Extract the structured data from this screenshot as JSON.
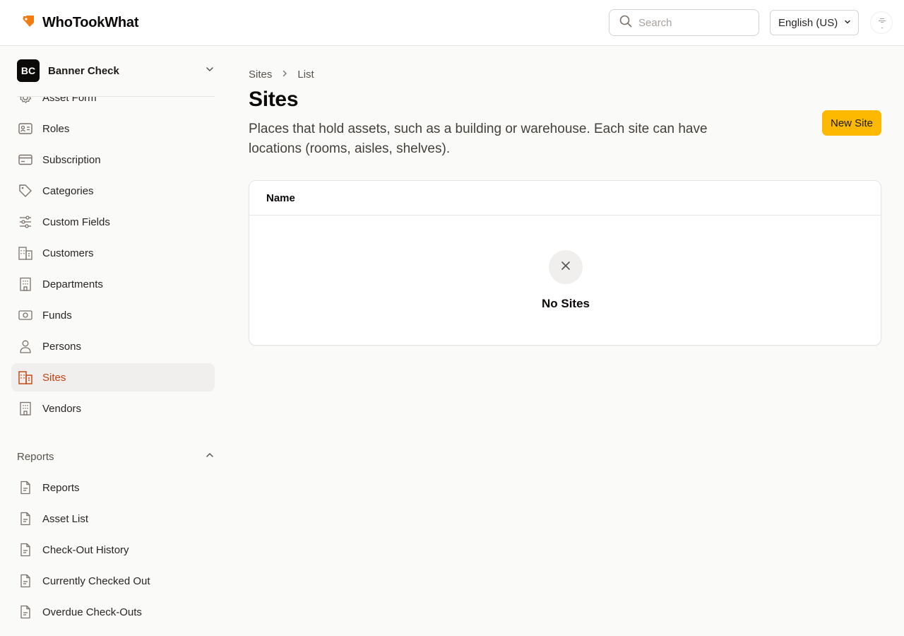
{
  "app": {
    "name": "WhoTookWhat",
    "brand_color": "#f07c12",
    "accent_color": "#fcb900"
  },
  "header": {
    "search_placeholder": "Search",
    "language": "English (US)"
  },
  "org": {
    "initials": "BC",
    "name": "Banner Check"
  },
  "sidebar": {
    "items": [
      {
        "label": "Asset Form",
        "icon": "gear-icon"
      },
      {
        "label": "Roles",
        "icon": "id-card-icon"
      },
      {
        "label": "Subscription",
        "icon": "credit-card-icon"
      },
      {
        "label": "Categories",
        "icon": "tag-icon"
      },
      {
        "label": "Custom Fields",
        "icon": "sliders-icon"
      },
      {
        "label": "Customers",
        "icon": "buildings-icon"
      },
      {
        "label": "Departments",
        "icon": "building-icon"
      },
      {
        "label": "Funds",
        "icon": "banknote-icon"
      },
      {
        "label": "Persons",
        "icon": "person-icon"
      },
      {
        "label": "Sites",
        "icon": "buildings-icon",
        "active": true
      },
      {
        "label": "Vendors",
        "icon": "building-icon"
      }
    ],
    "reports_section": {
      "label": "Reports",
      "items": [
        {
          "label": "Reports",
          "icon": "document-icon"
        },
        {
          "label": "Asset List",
          "icon": "document-icon"
        },
        {
          "label": "Check-Out History",
          "icon": "document-icon"
        },
        {
          "label": "Currently Checked Out",
          "icon": "document-icon"
        },
        {
          "label": "Overdue Check-Outs",
          "icon": "document-icon"
        }
      ]
    }
  },
  "main": {
    "breadcrumb": [
      "Sites",
      "List"
    ],
    "title": "Sites",
    "description": "Places that hold assets, such as a building or warehouse. Each site can have locations (rooms, aisles, shelves).",
    "new_button_label": "New Site",
    "table": {
      "columns": [
        "Name"
      ],
      "empty_text": "No Sites"
    }
  }
}
